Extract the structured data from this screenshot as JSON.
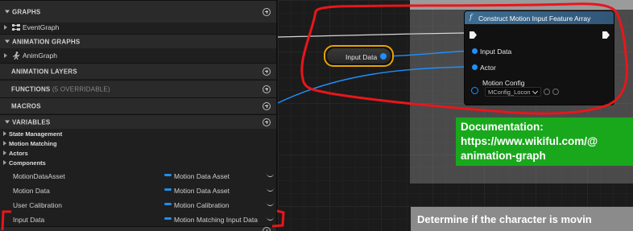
{
  "my_blueprint": {
    "graphs": {
      "title": "GRAPHS",
      "items": [
        {
          "label": "EventGraph",
          "icon": "event-graph-icon"
        }
      ]
    },
    "animation_graphs": {
      "title": "ANIMATION GRAPHS",
      "items": [
        {
          "label": "AnimGraph",
          "icon": "anim-graph-icon"
        }
      ]
    },
    "animation_layers": {
      "title": "ANIMATION LAYERS"
    },
    "functions": {
      "title": "FUNCTIONS",
      "subtitle": "(5 OVERRIDABLE)"
    },
    "macros": {
      "title": "MACROS"
    },
    "variables": {
      "title": "VARIABLES",
      "categories": [
        "State Management",
        "Motion Matching",
        "Actors",
        "Components"
      ],
      "items": [
        {
          "name": "MotionDataAsset",
          "type": "Motion Data Asset"
        },
        {
          "name": "Motion Data",
          "type": "Motion Data Asset"
        },
        {
          "name": "User Calibration",
          "type": "Motion Calibration"
        },
        {
          "name": "Input Data",
          "type": "Motion Matching Input Data"
        }
      ]
    }
  },
  "graph": {
    "get_node": {
      "label": "Input Data"
    },
    "construct_node": {
      "icon": "function-icon",
      "icon_glyph": "f",
      "title": "Construct Motion Input Feature Array",
      "pins": {
        "input_data": "Input Data",
        "actor": "Actor",
        "motion_config": "Motion Config"
      },
      "motion_config_value": "MConfig_Locon"
    },
    "documentation": {
      "heading": "Documentation:",
      "url_line1": "https://www.wikiful.com/@",
      "url_line2": "animation-graph"
    },
    "comment": "Determine if the character is movin"
  },
  "colors": {
    "struct_pin": "#1e90ff",
    "annotation": "#e8161b",
    "doc_green": "#19a81c",
    "node_header": "#3d6e93",
    "selection": "#e8a400"
  }
}
